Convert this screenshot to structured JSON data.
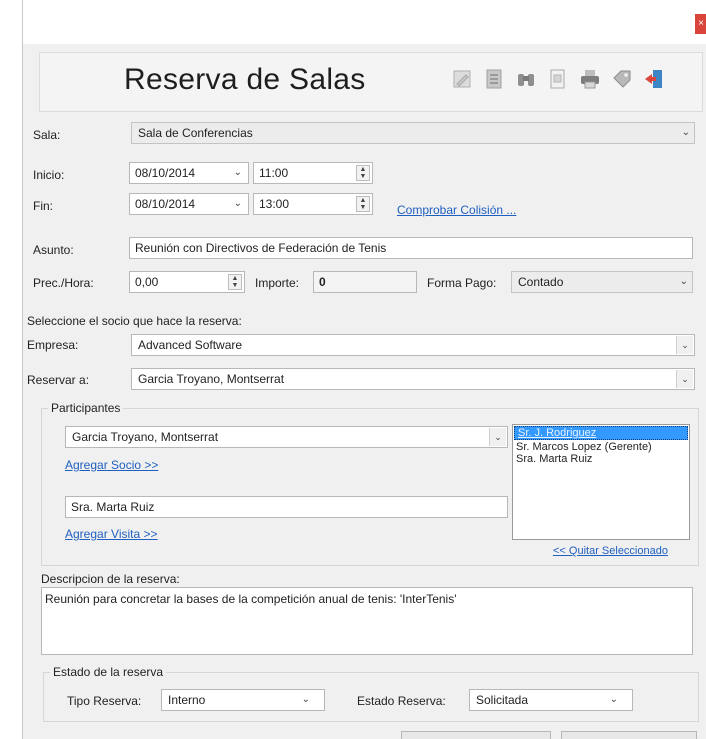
{
  "window": {
    "close_glyph": "×"
  },
  "header": {
    "title": "Reserva de Salas",
    "toolbar": [
      "edit-icon",
      "document-icon",
      "binoculars-icon",
      "page-icon",
      "printer-icon",
      "tag-icon",
      "exit-door-icon"
    ]
  },
  "form": {
    "sala_label": "Sala:",
    "sala_value": "Sala de Conferencias",
    "inicio_label": "Inicio:",
    "inicio_date": "08/10/2014",
    "inicio_time": "11:00",
    "fin_label": "Fin:",
    "fin_date": "08/10/2014",
    "fin_time": "13:00",
    "comprobar_link": "Comprobar Colisión ...",
    "asunto_label": "Asunto:",
    "asunto_value": "Reunión con Directivos de Federación de Tenis",
    "prec_label": "Prec./Hora:",
    "prec_value": "0,00",
    "importe_label": "Importe:",
    "importe_value": "0",
    "forma_pago_label": "Forma Pago:",
    "forma_pago_value": "Contado",
    "socio_prompt": "Seleccione el socio que hace la reserva:",
    "empresa_label": "Empresa:",
    "empresa_value": "Advanced Software",
    "reservar_label": "Reservar a:",
    "reservar_value": "Garcia Troyano, Montserrat"
  },
  "participantes": {
    "title": "Participantes",
    "socio_value": "Garcia Troyano, Montserrat",
    "agregar_socio": "Agregar Socio >>",
    "visita_value": "Sra. Marta Ruiz",
    "agregar_visita": "Agregar Visita >>",
    "quitar_link": "<< Quitar Seleccionado",
    "list": [
      "Sr. J. Rodriguez",
      "Sr. Marcos Lopez (Gerente)",
      "Sra. Marta Ruiz"
    ]
  },
  "descripcion": {
    "label": "Descripcion de la reserva:",
    "value": "Reunión para concretar la bases de la competición anual de tenis: 'InterTenis'"
  },
  "estado": {
    "title": "Estado de la reserva",
    "tipo_label": "Tipo Reserva:",
    "tipo_value": "Interno",
    "estado_label": "Estado Reserva:",
    "estado_value": "Solicitada"
  }
}
